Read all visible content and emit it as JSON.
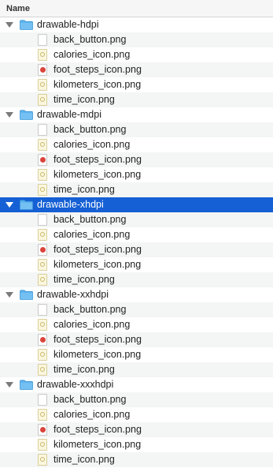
{
  "header": {
    "title": "Name"
  },
  "folders": [
    {
      "name": "drawable-hdpi",
      "selected": false,
      "files": [
        {
          "name": "back_button.png",
          "icon": "blank"
        },
        {
          "name": "calories_icon.png",
          "icon": "yellow"
        },
        {
          "name": "foot_steps_icon.png",
          "icon": "red"
        },
        {
          "name": "kilometers_icon.png",
          "icon": "yellow"
        },
        {
          "name": "time_icon.png",
          "icon": "yellow"
        }
      ]
    },
    {
      "name": "drawable-mdpi",
      "selected": false,
      "files": [
        {
          "name": "back_button.png",
          "icon": "blank"
        },
        {
          "name": "calories_icon.png",
          "icon": "yellow"
        },
        {
          "name": "foot_steps_icon.png",
          "icon": "red"
        },
        {
          "name": "kilometers_icon.png",
          "icon": "yellow"
        },
        {
          "name": "time_icon.png",
          "icon": "yellow"
        }
      ]
    },
    {
      "name": "drawable-xhdpi",
      "selected": true,
      "files": [
        {
          "name": "back_button.png",
          "icon": "blank"
        },
        {
          "name": "calories_icon.png",
          "icon": "yellow"
        },
        {
          "name": "foot_steps_icon.png",
          "icon": "red"
        },
        {
          "name": "kilometers_icon.png",
          "icon": "yellow"
        },
        {
          "name": "time_icon.png",
          "icon": "yellow"
        }
      ]
    },
    {
      "name": "drawable-xxhdpi",
      "selected": false,
      "files": [
        {
          "name": "back_button.png",
          "icon": "blank"
        },
        {
          "name": "calories_icon.png",
          "icon": "yellow"
        },
        {
          "name": "foot_steps_icon.png",
          "icon": "red"
        },
        {
          "name": "kilometers_icon.png",
          "icon": "yellow"
        },
        {
          "name": "time_icon.png",
          "icon": "yellow"
        }
      ]
    },
    {
      "name": "drawable-xxxhdpi",
      "selected": false,
      "files": [
        {
          "name": "back_button.png",
          "icon": "blank"
        },
        {
          "name": "calories_icon.png",
          "icon": "yellow"
        },
        {
          "name": "foot_steps_icon.png",
          "icon": "red"
        },
        {
          "name": "kilometers_icon.png",
          "icon": "yellow"
        },
        {
          "name": "time_icon.png",
          "icon": "yellow"
        }
      ]
    }
  ],
  "colors": {
    "selection": "#1560d4",
    "folder": "#5bb2ee",
    "stripe": "#f4f5f5"
  }
}
